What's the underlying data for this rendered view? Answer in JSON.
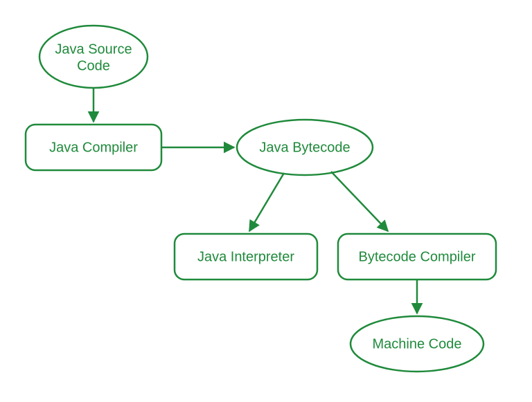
{
  "diagram": {
    "color": "#1f8a3b",
    "nodes": {
      "source": {
        "label_line1": "Java Source",
        "label_line2": "Code",
        "shape": "ellipse"
      },
      "compiler": {
        "label": "Java Compiler",
        "shape": "roundrect"
      },
      "bytecode": {
        "label": "Java Bytecode",
        "shape": "ellipse"
      },
      "interpreter": {
        "label": "Java Interpreter",
        "shape": "roundrect"
      },
      "bcc": {
        "label": "Bytecode Compiler",
        "shape": "roundrect"
      },
      "machine": {
        "label": "Machine Code",
        "shape": "ellipse"
      }
    },
    "edges": [
      {
        "from": "source",
        "to": "compiler"
      },
      {
        "from": "compiler",
        "to": "bytecode"
      },
      {
        "from": "bytecode",
        "to": "interpreter"
      },
      {
        "from": "bytecode",
        "to": "bcc"
      },
      {
        "from": "bcc",
        "to": "machine"
      }
    ]
  }
}
